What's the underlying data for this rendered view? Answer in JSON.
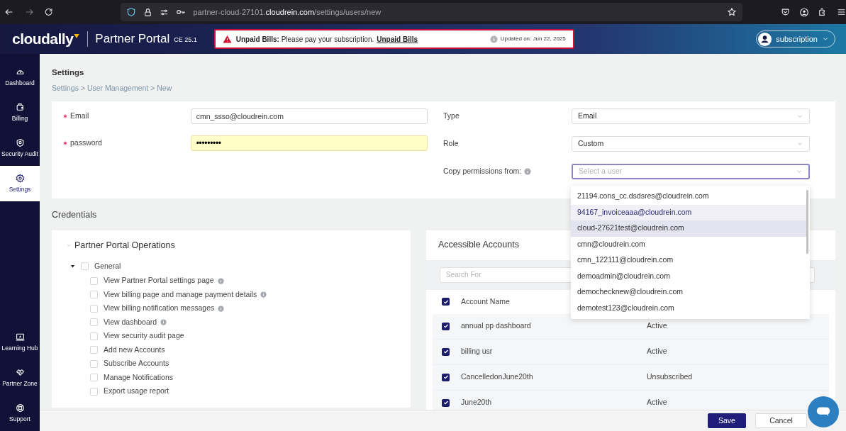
{
  "browser": {
    "url": {
      "subdomain": "partner-cloud-27101.",
      "domain": "cloudrein.com",
      "path": "/settings/users/new"
    }
  },
  "header": {
    "logo": "cloudally",
    "product": "Partner Portal",
    "version": "CE 25.1",
    "alert": {
      "message": "**Unpaid Bills:** Please pay your subscription.",
      "link": "Unpaid Bills",
      "updated": "Updated on: Jun 22, 2025"
    },
    "user_menu": "subscription"
  },
  "sidebar": {
    "items": [
      {
        "label": "Dashboard",
        "kind": "gauge",
        "selected": false
      },
      {
        "label": "Billing",
        "kind": "wallet",
        "selected": false
      },
      {
        "label": "Security Audit",
        "kind": "shield",
        "selected": false
      },
      {
        "label": "Settings",
        "kind": "gear",
        "selected": true
      }
    ],
    "bottom_items": [
      {
        "label": "Learning Hub",
        "kind": "laptop",
        "selected": false
      },
      {
        "label": "Partner Zone",
        "kind": "handshake",
        "selected": false
      },
      {
        "label": "Support",
        "kind": "lifebuoy",
        "selected": false
      }
    ]
  },
  "page": {
    "title": "Settings",
    "breadcrumb": "Settings > User Management > New"
  },
  "form": {
    "left": [
      {
        "label": "Email",
        "required": true,
        "kind": "text",
        "value": "cmn_ssso@cloudrein.com"
      },
      {
        "label": "password",
        "required": true,
        "kind": "password",
        "value": "•••••••••"
      }
    ],
    "right": [
      {
        "label": "Type",
        "info": false,
        "value": "Email",
        "focused": false
      },
      {
        "label": "Role",
        "info": false,
        "value": "Custom",
        "focused": false
      },
      {
        "label": "Copy permissions from:",
        "info": true,
        "placeholder": "Select a user",
        "focused": true
      }
    ]
  },
  "dropdown": {
    "options": [
      {
        "label": "21194.cons_cc.dsdsres@cloudrein.com",
        "selected": false,
        "hovered": false
      },
      {
        "label": "94167_invoiceaaa@cloudrein.com",
        "selected": false,
        "hovered": true
      },
      {
        "label": "cloud-27621test@cloudrein.com",
        "selected": true,
        "hovered": false
      },
      {
        "label": "cmn@cloudrein.com",
        "selected": false,
        "hovered": false
      },
      {
        "label": "cmn_122111@cloudrein.com",
        "selected": false,
        "hovered": false
      },
      {
        "label": "demoadmin@cloudrein.com",
        "selected": false,
        "hovered": false
      },
      {
        "label": "demochecknew@cloudrein.com",
        "selected": false,
        "hovered": false
      },
      {
        "label": "demotest123@cloudrein.com",
        "selected": false,
        "hovered": false
      }
    ]
  },
  "credentials": {
    "title": "Credentials",
    "operations": {
      "title": "Partner Portal Operations",
      "expanded": true,
      "groups": [
        {
          "label": "General",
          "expanded": true,
          "checked": false,
          "children": [
            {
              "label": "View Partner Portal settings page",
              "checked": false,
              "info": true
            },
            {
              "label": "View billing page and manage payment details",
              "checked": false,
              "info": true
            },
            {
              "label": "View billing notification messages",
              "checked": false,
              "info": true
            },
            {
              "label": "View dashboard",
              "checked": false,
              "info": true
            },
            {
              "label": "View security audit page",
              "checked": false,
              "info": false
            },
            {
              "label": "Add new Accounts",
              "checked": false,
              "info": false
            },
            {
              "label": "Subscribe Accounts",
              "checked": false,
              "info": false
            },
            {
              "label": "Manage Notifications",
              "checked": false,
              "info": false
            },
            {
              "label": "Export usage report",
              "checked": false,
              "info": false
            }
          ]
        }
      ]
    }
  },
  "accounts": {
    "title": "Accessible Accounts",
    "search_placeholder": "Search For",
    "column": "Account Name",
    "all_checked": true,
    "rows": [
      {
        "name": "annual pp dashboard",
        "status": "Active",
        "checked": true
      },
      {
        "name": "billing usr",
        "status": "Active",
        "checked": true
      },
      {
        "name": "CancelledonJune20th",
        "status": "Unsubscribed",
        "checked": true
      },
      {
        "name": "June20th",
        "status": "Active",
        "checked": true
      }
    ]
  },
  "footer": {
    "buttons": [
      {
        "label": "Save",
        "kind": "primary"
      },
      {
        "label": "Cancel",
        "kind": "secondary"
      }
    ]
  }
}
